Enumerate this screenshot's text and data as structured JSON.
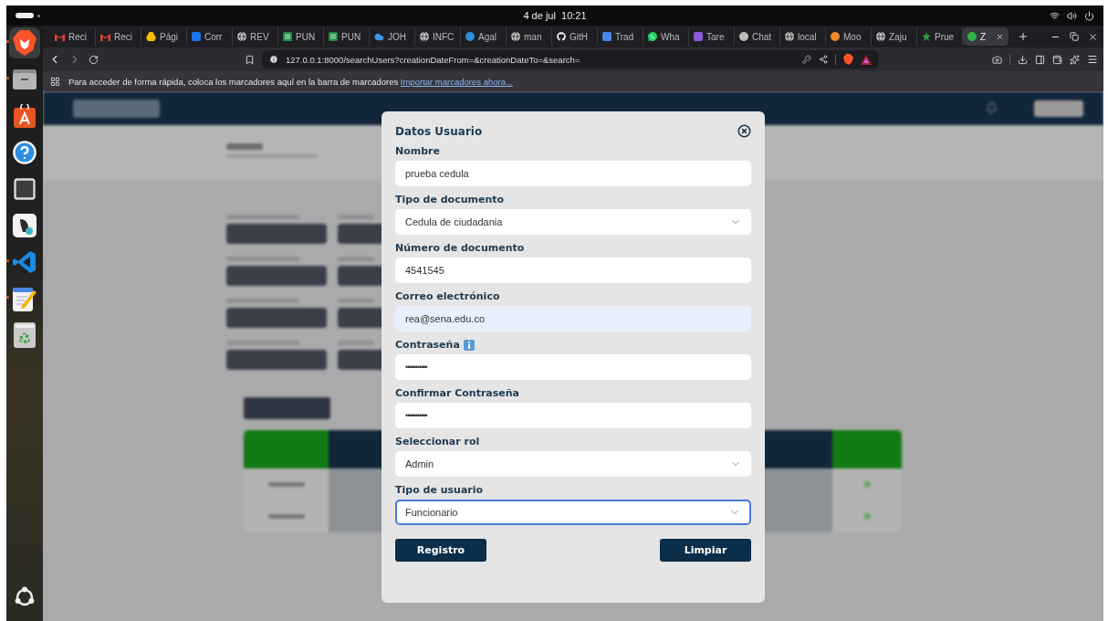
{
  "top_bar": {
    "clock": "4 de jul  10:21"
  },
  "dock": [
    {
      "kind": "browser",
      "running": true,
      "selected": true
    },
    {
      "kind": "files",
      "running": true,
      "selected": false
    },
    {
      "kind": "store",
      "running": false,
      "selected": false
    },
    {
      "kind": "help",
      "running": false,
      "selected": false
    },
    {
      "kind": "terminal",
      "running": false,
      "selected": false
    },
    {
      "kind": "app",
      "running": false,
      "selected": false
    },
    {
      "kind": "code",
      "running": true,
      "selected": false
    },
    {
      "kind": "notes",
      "running": true,
      "selected": false
    },
    {
      "kind": "trash",
      "running": false,
      "selected": false
    }
  ],
  "tabs": [
    {
      "label": "Reci",
      "kind": "envelope",
      "color": "#ea4335",
      "selected": false
    },
    {
      "label": "Reci",
      "kind": "envelope",
      "color": "#ea4335",
      "selected": false
    },
    {
      "label": "Pági",
      "kind": "triangle",
      "color": "#fbbc04",
      "selected": false
    },
    {
      "label": "Corr",
      "kind": "square",
      "color": "#1a73e8",
      "selected": false
    },
    {
      "label": "REV",
      "kind": "globe",
      "color": "#c8c8c8",
      "selected": false
    },
    {
      "label": "PUN",
      "kind": "sheet",
      "color": "#1e8e3e",
      "selected": false
    },
    {
      "label": "PUN",
      "kind": "sheet",
      "color": "#1e8e3e",
      "selected": false
    },
    {
      "label": "JOH",
      "kind": "cloud",
      "color": "#3b9be8",
      "selected": false
    },
    {
      "label": "INFC",
      "kind": "globe",
      "color": "#c8c8c8",
      "selected": false
    },
    {
      "label": "Agal",
      "kind": "circle",
      "color": "#2a8fd8",
      "selected": false
    },
    {
      "label": "man",
      "kind": "globe",
      "color": "#c8c8c8",
      "selected": false
    },
    {
      "label": "GitH",
      "kind": "github",
      "color": "#f0f0f0",
      "selected": false
    },
    {
      "label": "Trad",
      "kind": "square",
      "color": "#4a86e8",
      "selected": false
    },
    {
      "label": "Wha",
      "kind": "bubble",
      "color": "#25d366",
      "selected": false
    },
    {
      "label": "Tare",
      "kind": "square",
      "color": "#8e5bd8",
      "selected": false
    },
    {
      "label": "Chat",
      "kind": "circle",
      "color": "#bdbdbd",
      "selected": false
    },
    {
      "label": "local",
      "kind": "globe",
      "color": "#c8c8c8",
      "selected": false
    },
    {
      "label": "Moo",
      "kind": "circle",
      "color": "#f08a24",
      "selected": false
    },
    {
      "label": "Zaju",
      "kind": "globe",
      "color": "#c8c8c8",
      "selected": false
    },
    {
      "label": "Prue",
      "kind": "star",
      "color": "#2e9d3a",
      "selected": false
    },
    {
      "label": "Z",
      "kind": "circle",
      "color": "#2fb34a",
      "selected": true
    }
  ],
  "address_bar": {
    "url": "127.0.0.1:8000/searchUsers?creationDateFrom=&creationDateTo=&search="
  },
  "bookmarks_bar": {
    "message": "Para acceder de forma rápida, coloca los marcadores aquí en la barra de marcadores",
    "link": "Importar marcadores ahora..."
  },
  "dialog": {
    "title": "Datos Usuario",
    "fields": [
      {
        "label": "Nombre",
        "kind": "text",
        "value": "prueba cedula",
        "info": false,
        "autofilled": false,
        "focused": false
      },
      {
        "label": "Tipo de documento",
        "kind": "select",
        "value": "Cedula de ciudadania",
        "info": false,
        "autofilled": false,
        "focused": false
      },
      {
        "label": "Número de documento",
        "kind": "text",
        "value": "4541545",
        "info": false,
        "autofilled": false,
        "focused": false
      },
      {
        "label": "Correo electrónico",
        "kind": "text",
        "value": "rea@sena.edu.co",
        "info": false,
        "autofilled": true,
        "focused": false
      },
      {
        "label": "Contraseña",
        "kind": "password",
        "value": "•••••••••••",
        "info": true,
        "autofilled": false,
        "focused": false
      },
      {
        "label": "Confirmar Contraseña",
        "kind": "password",
        "value": "•••••••••••",
        "info": false,
        "autofilled": false,
        "focused": false
      },
      {
        "label": "Seleccionar rol",
        "kind": "select",
        "value": "Admin",
        "info": false,
        "autofilled": false,
        "focused": false
      },
      {
        "label": "Tipo de usuario",
        "kind": "select",
        "value": "Funcionario",
        "info": false,
        "autofilled": false,
        "focused": true
      }
    ],
    "buttons": [
      {
        "label": "Registro"
      },
      {
        "label": "Limpiar"
      }
    ]
  }
}
